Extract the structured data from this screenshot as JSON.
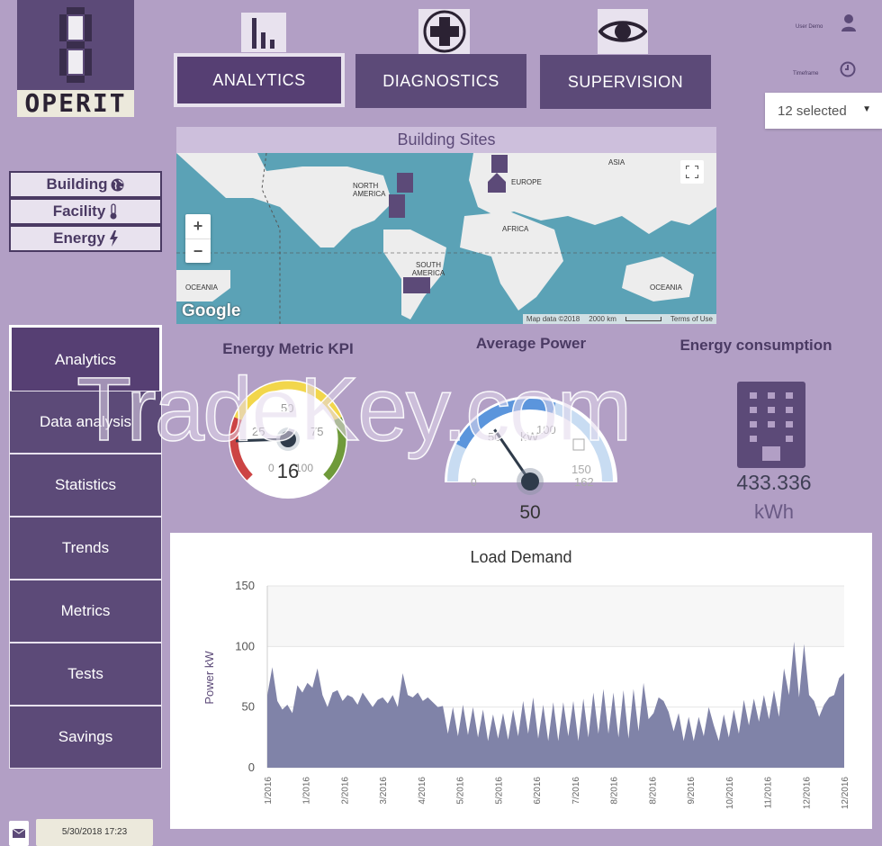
{
  "logo": {
    "text": "OPERIT"
  },
  "top_nav": [
    {
      "label": "ANALYTICS",
      "icon": "bar-chart-icon",
      "active": true
    },
    {
      "label": "DIAGNOSTICS",
      "icon": "medical-cross-icon",
      "active": false
    },
    {
      "label": "SUPERVISION",
      "icon": "eye-icon",
      "active": false
    }
  ],
  "user": {
    "label": "User Demo",
    "icon": "user-icon"
  },
  "timeframe": {
    "label": "Timeframe",
    "icon": "clock-icon"
  },
  "site_select": {
    "value": "12 selected"
  },
  "filters": [
    {
      "label": "Building",
      "icon": "globe-icon"
    },
    {
      "label": "Facility",
      "icon": "thermometer-icon"
    },
    {
      "label": "Energy",
      "icon": "bolt-icon"
    }
  ],
  "sidebar": {
    "items": [
      {
        "label": "Analytics",
        "active": true
      },
      {
        "label": "Data analysis"
      },
      {
        "label": "Statistics"
      },
      {
        "label": "Trends"
      },
      {
        "label": "Metrics"
      },
      {
        "label": "Tests"
      },
      {
        "label": "Savings"
      }
    ]
  },
  "map": {
    "title": "Building Sites",
    "labels": {
      "north_america": "NORTH AMERICA",
      "europe": "EUROPE",
      "asia": "ASIA",
      "africa": "AFRICA",
      "south_america": "SOUTH AMERICA",
      "oceania_left": "OCEANIA",
      "oceania_right": "OCEANIA"
    },
    "google": "Google",
    "map_data": "Map data ©2018",
    "scale": "2000 km",
    "terms": "Terms of Use",
    "zoom_in": "+",
    "zoom_out": "−",
    "colors": {
      "water": "#5ba2b6",
      "land": "#ededed"
    }
  },
  "kpi": {
    "metric": {
      "title": "Energy Metric KPI",
      "value": "16",
      "min": "0",
      "max": "100",
      "ticks": [
        "0",
        "25",
        "50",
        "75",
        "100"
      ],
      "value_num": 16
    },
    "power": {
      "title": "Average Power",
      "value": "50",
      "unit": "kW",
      "min": "0",
      "max": "162",
      "ticks": [
        "0",
        "50",
        "100",
        "150"
      ],
      "max_label": "162",
      "value_num": 50
    },
    "consumption": {
      "title": "Energy consumption",
      "value": "433.336",
      "unit": "kWh",
      "icon": "building-icon"
    }
  },
  "chart_data": {
    "type": "area",
    "title": "Load Demand",
    "xlabel": "",
    "ylabel": "Power kW",
    "ylim": [
      0,
      150
    ],
    "yticks": [
      "0",
      "50",
      "100",
      "150"
    ],
    "xticks": [
      "1/2016",
      "1/2016",
      "2/2016",
      "3/2016",
      "4/2016",
      "5/2016",
      "5/2016",
      "6/2016",
      "7/2016",
      "8/2016",
      "8/2016",
      "9/2016",
      "10/2016",
      "11/2016",
      "12/2016",
      "12/2016"
    ],
    "grid": true,
    "color": "#8083a8",
    "values": [
      60,
      83,
      55,
      48,
      52,
      45,
      68,
      62,
      70,
      66,
      82,
      60,
      50,
      62,
      64,
      55,
      60,
      58,
      52,
      62,
      56,
      50,
      56,
      58,
      53,
      60,
      50,
      78,
      60,
      58,
      62,
      55,
      58,
      54,
      50,
      51,
      28,
      50,
      26,
      52,
      27,
      50,
      25,
      48,
      22,
      44,
      24,
      45,
      23,
      48,
      26,
      55,
      28,
      58,
      24,
      52,
      22,
      54,
      22,
      54,
      26,
      55,
      22,
      57,
      25,
      62,
      28,
      65,
      28,
      62,
      25,
      64,
      24,
      65,
      30,
      70,
      40,
      45,
      58,
      55,
      46,
      30,
      45,
      22,
      42,
      22,
      42,
      26,
      50,
      35,
      22,
      44,
      25,
      48,
      28,
      56,
      35,
      57,
      38,
      60,
      40,
      64,
      42,
      82,
      60,
      104,
      58,
      102,
      60,
      55,
      42,
      52,
      58,
      60,
      74,
      78
    ]
  },
  "footer": {
    "datetime": "5/30/2018  17:23",
    "mail_icon": "envelope-icon"
  },
  "watermark": "TradeKey.com",
  "colors": {
    "background": "#b29fc5",
    "primary": "#5c4a78",
    "panel": "#e8e2ee"
  }
}
